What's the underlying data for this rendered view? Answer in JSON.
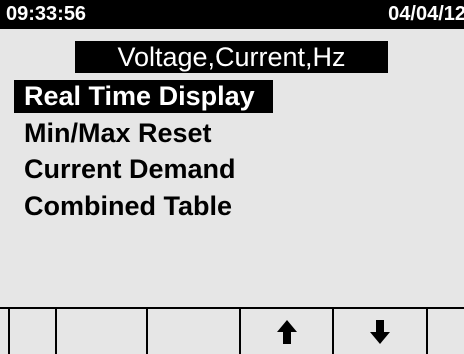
{
  "status": {
    "time": "09:33:56",
    "date": "04/04/12"
  },
  "menu": {
    "title": "Voltage,Current,Hz",
    "items": [
      {
        "label": "Real Time Display",
        "selected": true
      },
      {
        "label": "Min/Max Reset",
        "selected": false
      },
      {
        "label": "Current Demand",
        "selected": false
      },
      {
        "label": "Combined Table",
        "selected": false
      }
    ]
  },
  "softkeys": [
    {
      "icon": "blank"
    },
    {
      "icon": "blank"
    },
    {
      "icon": "blank"
    },
    {
      "icon": "up-arrow-icon"
    },
    {
      "icon": "down-arrow-icon"
    },
    {
      "icon": "blank"
    }
  ],
  "colors": {
    "background": "#e6e6e6",
    "foreground": "#000000",
    "highlight_text": "#ffffff"
  }
}
